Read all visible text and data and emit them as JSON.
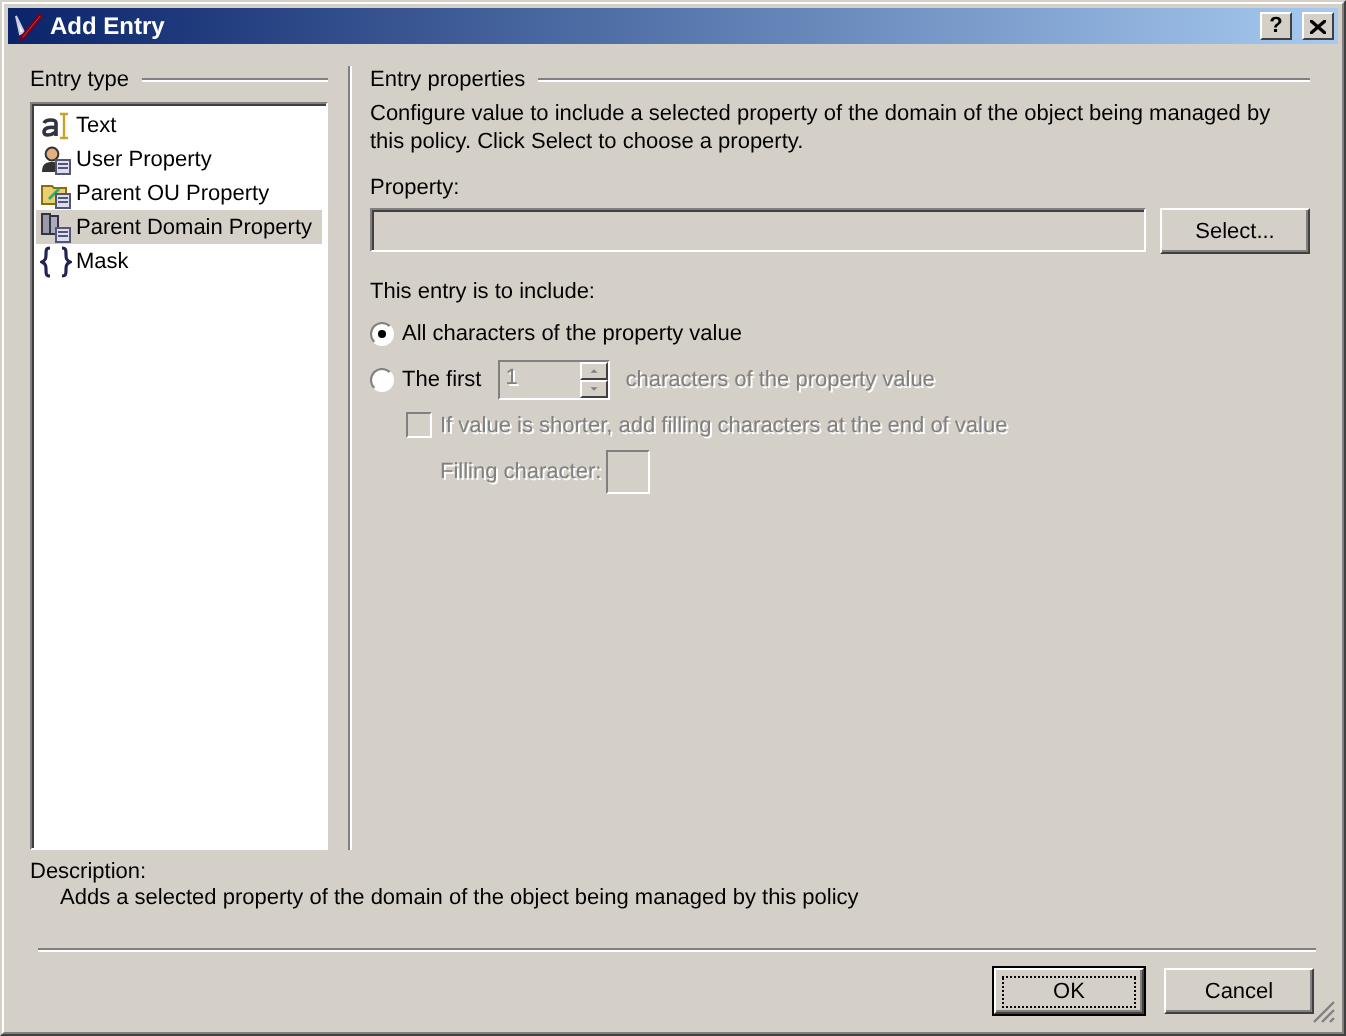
{
  "window": {
    "title": "Add Entry",
    "help_button": "?"
  },
  "entry_type": {
    "legend": "Entry type",
    "items": [
      {
        "label": "Text",
        "kind": "text",
        "selected": false
      },
      {
        "label": "User Property",
        "kind": "user",
        "selected": false
      },
      {
        "label": "Parent OU Property",
        "kind": "ou",
        "selected": false
      },
      {
        "label": "Parent Domain Property",
        "kind": "domain",
        "selected": true
      },
      {
        "label": "Mask",
        "kind": "mask",
        "selected": false
      }
    ]
  },
  "entry_properties": {
    "legend": "Entry properties",
    "intro": "Configure value to include a selected property of the domain of the object being managed by this policy. Click Select to choose a property.",
    "property_label": "Property:",
    "select_button": "Select...",
    "include_label": "This entry is to include:",
    "options": [
      {
        "label": "All characters of the property value",
        "selected": true,
        "disabled": false
      },
      {
        "label": "The first",
        "spin_value": "1",
        "suffix": "characters of the property value",
        "selected": false,
        "disabled": false
      }
    ],
    "fill_checkbox": {
      "label": "If value is shorter, add filling characters at the end of value",
      "checked": false,
      "disabled": true
    },
    "filling_character": {
      "label": "Filling character:",
      "disabled": true
    }
  },
  "description": {
    "label": "Description:",
    "text": "Adds a selected property of the domain of the object being managed by this policy"
  },
  "buttons": [
    {
      "label": "OK",
      "default": true
    },
    {
      "label": "Cancel",
      "default": false
    }
  ]
}
